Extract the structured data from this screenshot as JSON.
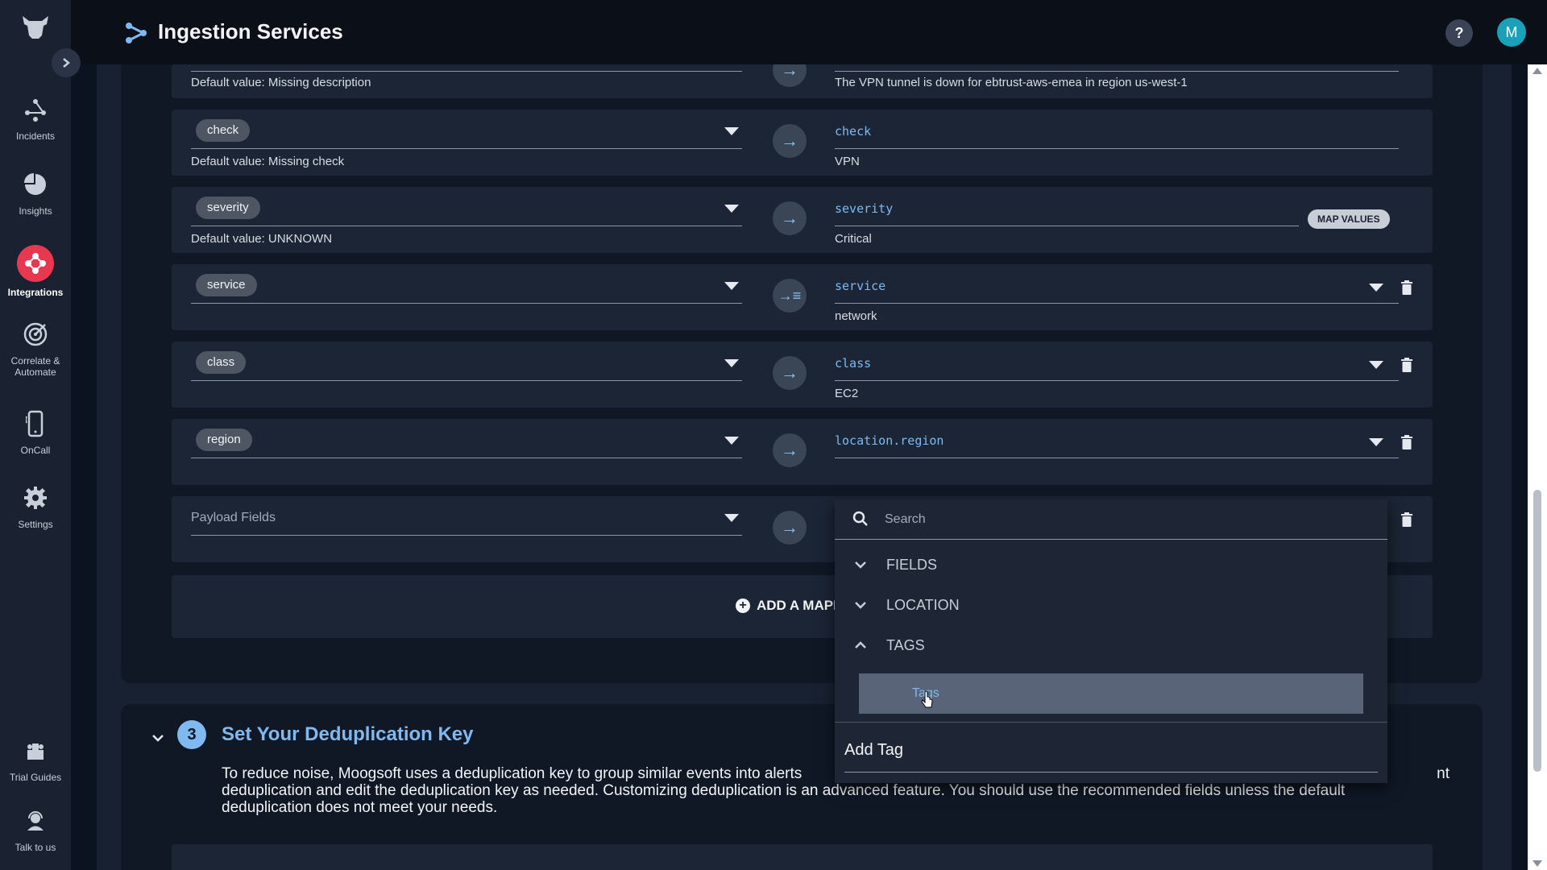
{
  "header": {
    "title": "Ingestion Services"
  },
  "user": {
    "initial": "M"
  },
  "help": {
    "label": "?"
  },
  "sidebar": {
    "items": [
      {
        "label": "Incidents"
      },
      {
        "label": "Insights"
      },
      {
        "label": "Integrations"
      },
      {
        "label": "Correlate &\nAutomate"
      },
      {
        "label": "OnCall"
      },
      {
        "label": "Settings"
      },
      {
        "label": "Trial Guides"
      },
      {
        "label": "Talk to us"
      }
    ]
  },
  "mappings": [
    {
      "default": "Default value: Missing description",
      "target_value": "The VPN tunnel is down for ebtrust-aws-emea in region us-west-1"
    },
    {
      "source": "check",
      "default": "Default value: Missing check",
      "target": "check",
      "target_value": "VPN"
    },
    {
      "source": "severity",
      "default": "Default value: UNKNOWN",
      "target": "severity",
      "target_value": "Critical",
      "map_values": "MAP VALUES"
    },
    {
      "source": "service",
      "target": "service",
      "target_value": "network"
    },
    {
      "source": "class",
      "target": "class",
      "target_value": "EC2"
    },
    {
      "source": "region",
      "target": "location.region"
    },
    {
      "source_placeholder": "Payload Fields"
    }
  ],
  "add_mapping": {
    "label": "ADD A MAPP"
  },
  "dropdown": {
    "search_placeholder": "Search",
    "groups": [
      {
        "label": "FIELDS"
      },
      {
        "label": "LOCATION"
      },
      {
        "label": "TAGS"
      }
    ],
    "highlighted_option": "Tags",
    "add_tag": "Add Tag"
  },
  "step3": {
    "number": "3",
    "title": "Set Your Deduplication Key",
    "description_line1": "To reduce noise, Moogsoft uses a deduplication key to group similar events into alerts",
    "description_line1_tail": "nt",
    "description_line2": "deduplication and edit the deduplication key as needed. Customizing deduplication is an advanced feature. You should use the recommended fields unless the default",
    "description_line3": "deduplication does not meet your needs."
  },
  "colors": {
    "accent": "#7fb9ef",
    "integrations_active": "#e8384f",
    "avatar": "#1aa0b8"
  }
}
